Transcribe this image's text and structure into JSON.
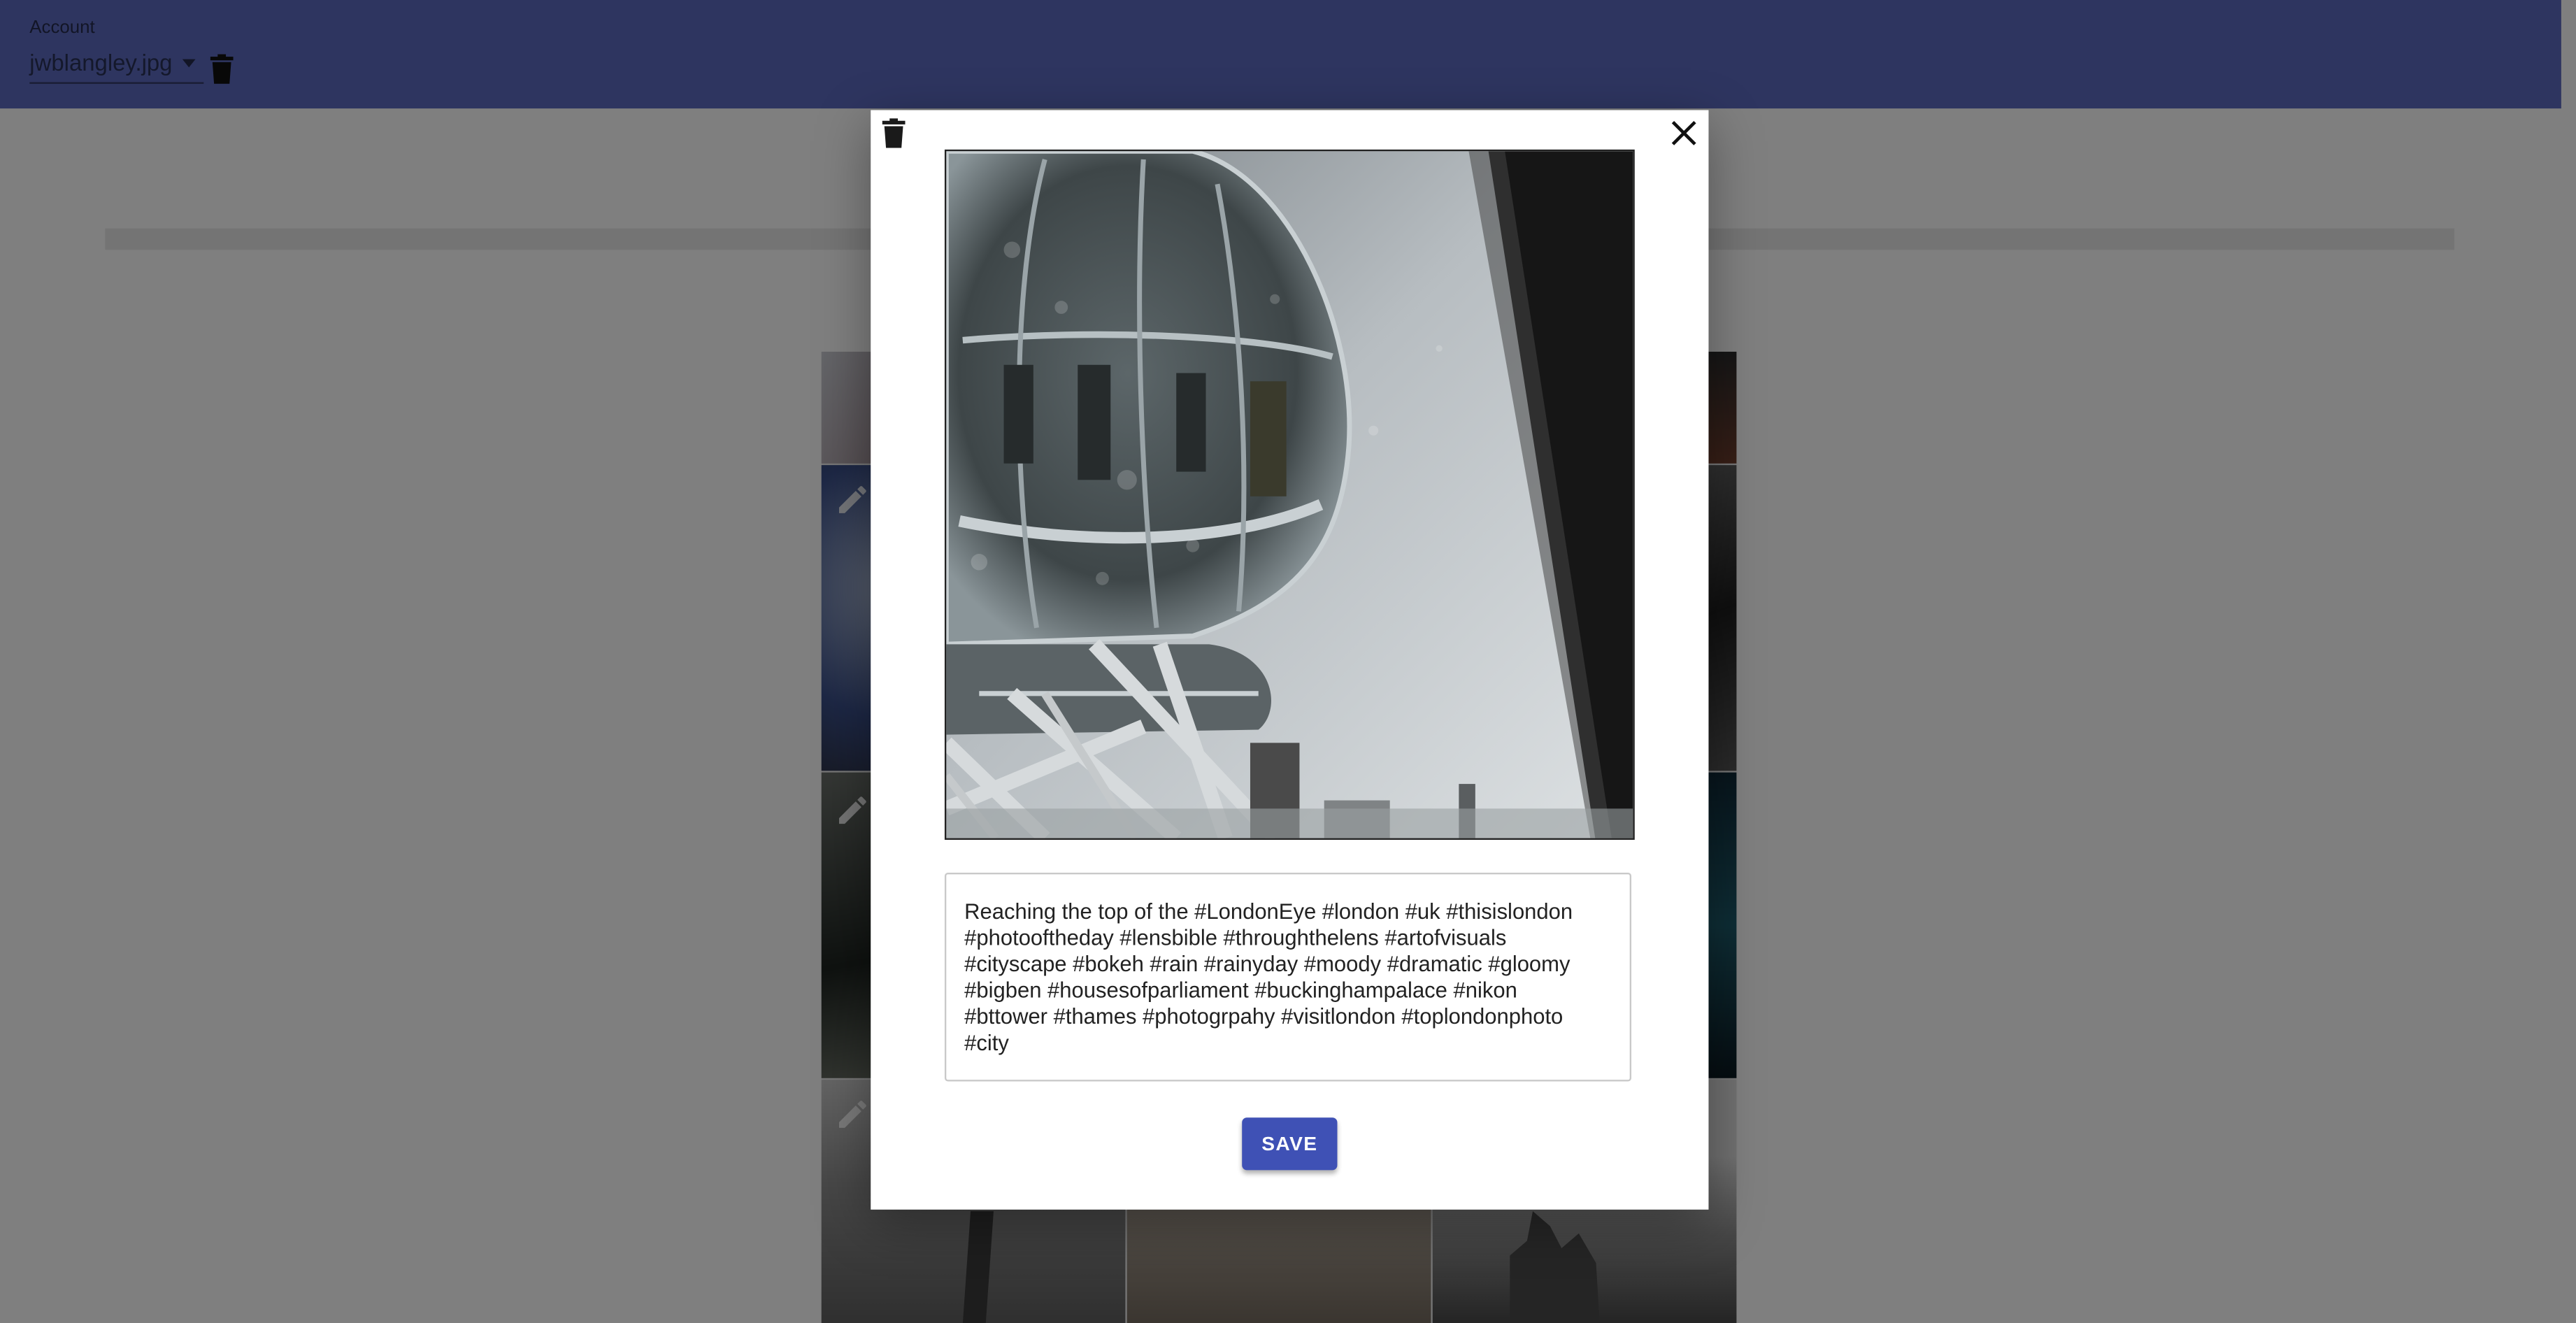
{
  "header": {
    "account_label": "Account",
    "account_selected": "jwblangley.jpg",
    "delete_icon": "trash-icon",
    "select_icon": "caret-down-icon"
  },
  "dialog": {
    "delete_icon": "trash-icon",
    "close_icon": "close-icon",
    "photo_alt": "London Eye capsule against a rainy grey sky",
    "caption": "Reaching the top of the #LondonEye #london #uk #thisislondon\n#photooftheday #lensbible #throughthelens #artofvisuals\n#cityscape #bokeh #rain #rainyday #moody #dramatic #gloomy\n#bigben #housesofparliament #buckinghampalace #nikon\n#bttower #thames #photogrpahy #visitlondon #toplondonphoto\n#city",
    "save_label": "SAVE"
  },
  "gallery": {
    "edit_icon": "pencil-icon"
  },
  "colors": {
    "app_bar": "#5c6bc0",
    "save_button": "#3f51b5",
    "scrim": "rgba(0,0,0,0.5)"
  }
}
